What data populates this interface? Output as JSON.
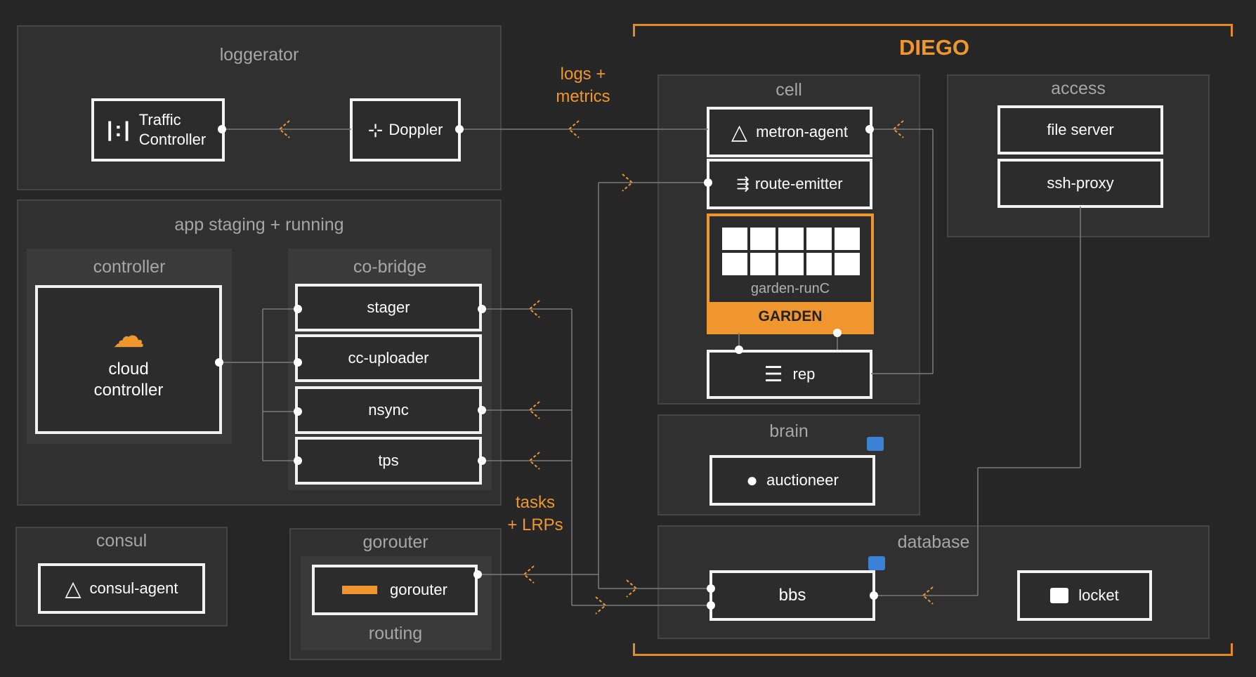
{
  "diego": {
    "title": "DIEGO"
  },
  "loggerator": {
    "title": "loggerator",
    "traffic_controller": "Traffic\nController",
    "doppler": "Doppler"
  },
  "logs_metrics": "logs +\nmetrics",
  "staging": {
    "title": "app staging + running",
    "controller": {
      "title": "controller",
      "cloud_controller": "cloud\ncontroller"
    },
    "cc_bridge": {
      "title": "co-bridge",
      "items": [
        "stager",
        "cc-uploader",
        "nsync",
        "tps"
      ]
    }
  },
  "tasks_lrps": "tasks\n+ LRPs",
  "consul": {
    "title": "consul",
    "agent": "consul-agent"
  },
  "gorouter_panel": {
    "title": "gorouter",
    "box": "gorouter",
    "footer": "routing"
  },
  "cell": {
    "title": "cell",
    "metron": "metron-agent",
    "route_emitter": "route-emitter",
    "garden_runc": "garden-runC",
    "garden": "GARDEN",
    "rep": "rep"
  },
  "access": {
    "title": "access",
    "file_server": "file server",
    "ssh_proxy": "ssh-proxy"
  },
  "brain": {
    "title": "brain",
    "auctioneer": "auctioneer"
  },
  "database": {
    "title": "database",
    "bbs": "bbs",
    "locket": "locket"
  },
  "colors": {
    "accent": "#f0962e",
    "lock_blue": "#3b82d6",
    "panel": "#303030",
    "background": "#262626"
  }
}
